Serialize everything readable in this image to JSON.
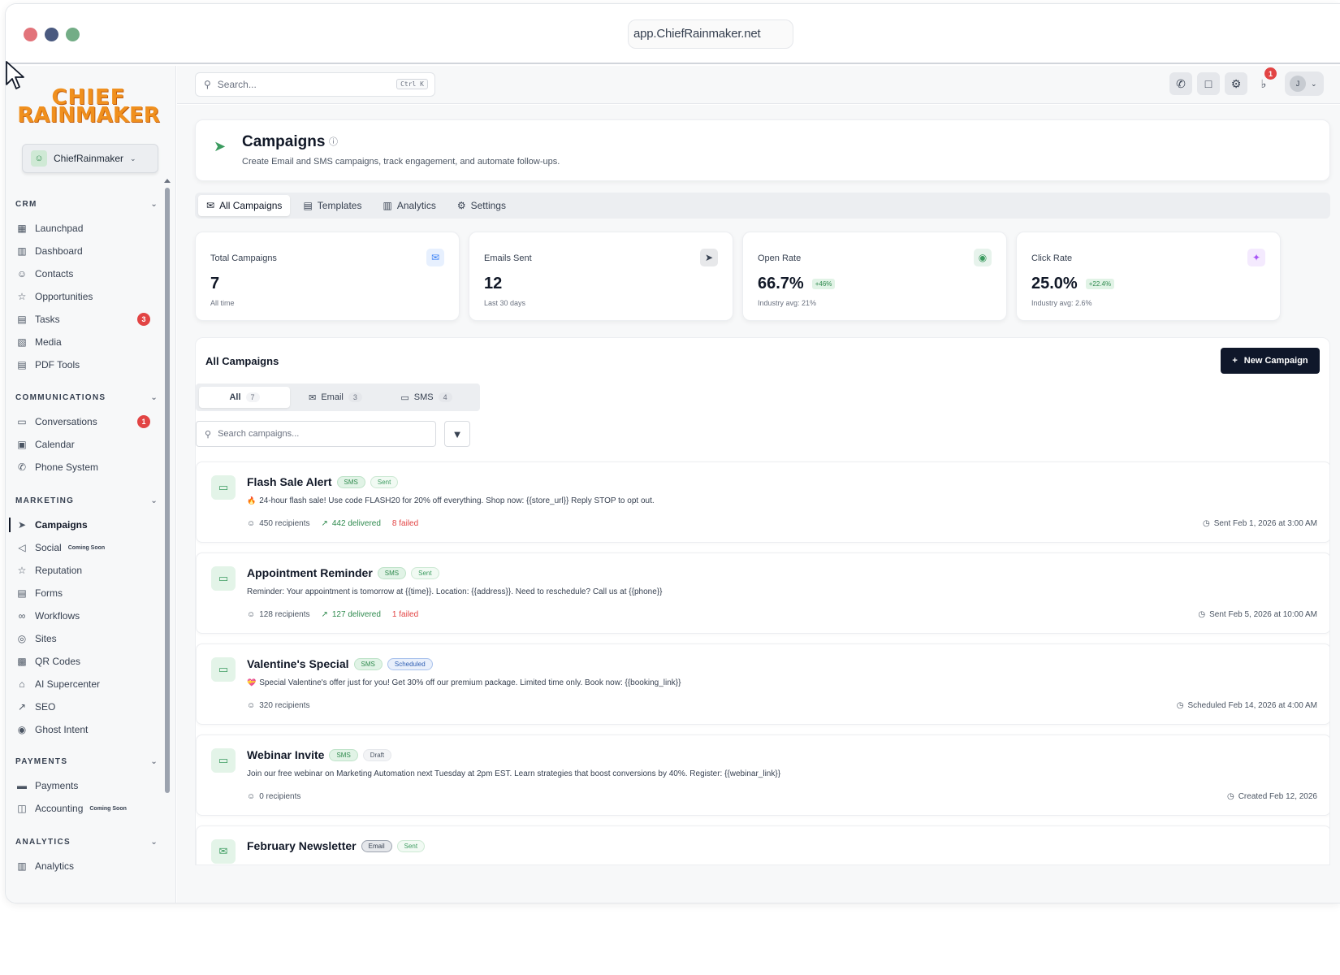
{
  "browser": {
    "url": "app.ChiefRainmaker.net"
  },
  "brand": {
    "line1": "CHIEF",
    "line2": "RAINMAKER"
  },
  "account": {
    "name": "ChiefRainmaker"
  },
  "search": {
    "placeholder": "Search...",
    "shortcut": "Ctrl K"
  },
  "topbar": {
    "notification_count": "1",
    "avatar_initial": "J"
  },
  "sidebar": {
    "sections": [
      {
        "title": "CRM",
        "items": [
          {
            "label": "Launchpad",
            "icon": "grid-icon"
          },
          {
            "label": "Dashboard",
            "icon": "bar-chart-icon"
          },
          {
            "label": "Contacts",
            "icon": "users-icon"
          },
          {
            "label": "Opportunities",
            "icon": "star-icon"
          },
          {
            "label": "Tasks",
            "icon": "document-icon",
            "badge": "3"
          },
          {
            "label": "Media",
            "icon": "image-icon"
          },
          {
            "label": "PDF Tools",
            "icon": "document-icon"
          }
        ]
      },
      {
        "title": "COMMUNICATIONS",
        "items": [
          {
            "label": "Conversations",
            "icon": "message-icon",
            "badge": "1"
          },
          {
            "label": "Calendar",
            "icon": "calendar-icon"
          },
          {
            "label": "Phone System",
            "icon": "phone-icon"
          }
        ]
      },
      {
        "title": "MARKETING",
        "items": [
          {
            "label": "Campaigns",
            "icon": "send-icon",
            "active": true
          },
          {
            "label": "Social",
            "icon": "megaphone-icon",
            "soon": "Coming Soon"
          },
          {
            "label": "Reputation",
            "icon": "star-icon"
          },
          {
            "label": "Forms",
            "icon": "document-icon"
          },
          {
            "label": "Workflows",
            "icon": "workflow-icon"
          },
          {
            "label": "Sites",
            "icon": "globe-icon"
          },
          {
            "label": "QR Codes",
            "icon": "qr-icon"
          },
          {
            "label": "AI Supercenter",
            "icon": "bot-icon"
          },
          {
            "label": "SEO",
            "icon": "trend-icon"
          },
          {
            "label": "Ghost Intent",
            "icon": "eye-icon"
          }
        ]
      },
      {
        "title": "PAYMENTS",
        "items": [
          {
            "label": "Payments",
            "icon": "card-icon"
          },
          {
            "label": "Accounting",
            "icon": "book-icon",
            "soon": "Coming Soon"
          }
        ]
      },
      {
        "title": "ANALYTICS",
        "items": [
          {
            "label": "Analytics",
            "icon": "bar-chart-icon"
          }
        ]
      }
    ]
  },
  "page": {
    "title": "Campaigns",
    "subtitle": "Create Email and SMS campaigns, track engagement, and automate follow-ups.",
    "tabs": [
      {
        "label": "All Campaigns",
        "icon": "mail-icon"
      },
      {
        "label": "Templates",
        "icon": "document-icon"
      },
      {
        "label": "Analytics",
        "icon": "bar-chart-icon"
      },
      {
        "label": "Settings",
        "icon": "gear-icon"
      }
    ]
  },
  "stats": [
    {
      "label": "Total Campaigns",
      "value": "7",
      "foot": "All time",
      "delta": "",
      "accent": "#3b82f6"
    },
    {
      "label": "Emails Sent",
      "value": "12",
      "foot": "Last 30 days",
      "delta": "",
      "accent": "#374151"
    },
    {
      "label": "Open Rate",
      "value": "66.7%",
      "foot": "Industry avg: 21%",
      "delta": "+46%",
      "accent": "#3b9b5f"
    },
    {
      "label": "Click Rate",
      "value": "25.0%",
      "foot": "Industry avg: 2.6%",
      "delta": "+22.4%",
      "accent": "#a855f7"
    }
  ],
  "list": {
    "title": "All Campaigns",
    "new_button": "New Campaign",
    "filters": [
      {
        "label": "All",
        "count": "7"
      },
      {
        "label": "Email",
        "count": "3"
      },
      {
        "label": "SMS",
        "count": "4"
      }
    ],
    "search_placeholder": "Search campaigns..."
  },
  "campaigns": [
    {
      "name": "Flash Sale Alert",
      "type": "SMS",
      "status": "Sent",
      "prefix": "🔥",
      "message": "24-hour flash sale! Use code FLASH20 for 20% off everything. Shop now: {{store_url}} Reply STOP to opt out.",
      "recipients": "450 recipients",
      "delivered": "442 delivered",
      "failed": "8 failed",
      "date": "Sent Feb 1, 2026 at 3:00 AM"
    },
    {
      "name": "Appointment Reminder",
      "type": "SMS",
      "status": "Sent",
      "prefix": "",
      "message": "Reminder: Your appointment is tomorrow at {{time}}. Location: {{address}}. Need to reschedule? Call us at {{phone}}",
      "recipients": "128 recipients",
      "delivered": "127 delivered",
      "failed": "1 failed",
      "date": "Sent Feb 5, 2026 at 10:00 AM"
    },
    {
      "name": "Valentine's Special",
      "type": "SMS",
      "status": "Scheduled",
      "prefix": "💝",
      "message": "Special Valentine's offer just for you! Get 30% off our premium package. Limited time only. Book now: {{booking_link}}",
      "recipients": "320 recipients",
      "delivered": "",
      "failed": "",
      "date": "Scheduled Feb 14, 2026 at 4:00 AM"
    },
    {
      "name": "Webinar Invite",
      "type": "SMS",
      "status": "Draft",
      "prefix": "",
      "message": "Join our free webinar on Marketing Automation next Tuesday at 2pm EST. Learn strategies that boost conversions by 40%. Register: {{webinar_link}}",
      "recipients": "0 recipients",
      "delivered": "",
      "failed": "",
      "date": "Created Feb 12, 2026"
    },
    {
      "name": "February Newsletter",
      "type": "Email",
      "status": "Sent",
      "prefix": "",
      "message": "",
      "recipients": "",
      "delivered": "",
      "failed": "",
      "date": ""
    }
  ]
}
